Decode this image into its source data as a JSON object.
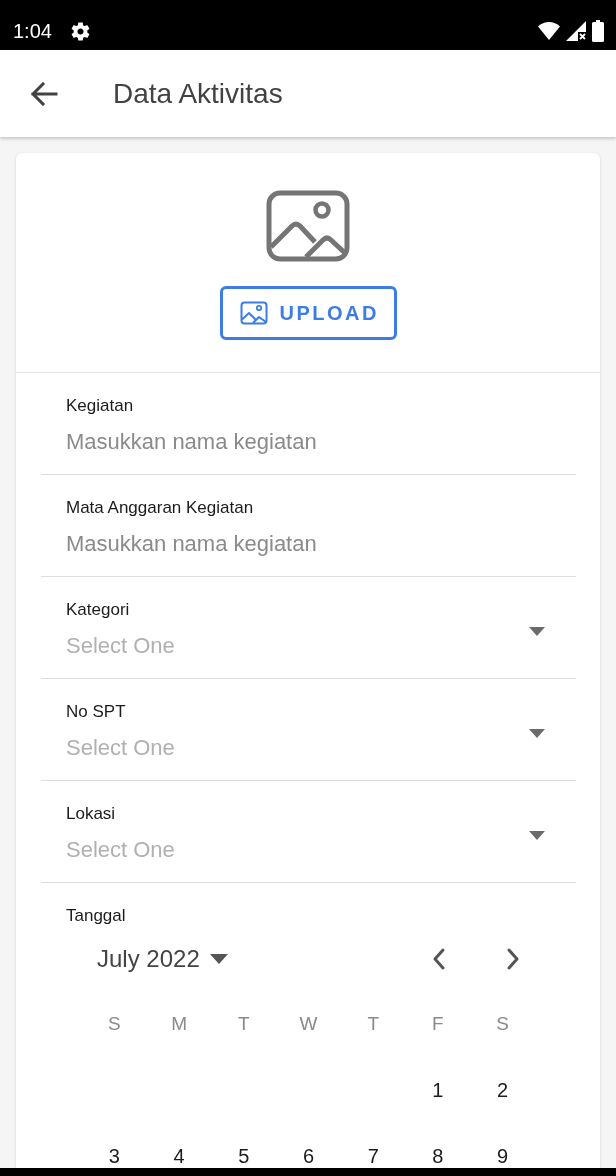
{
  "status_bar": {
    "time": "1:04"
  },
  "app_bar": {
    "title": "Data Aktivitas"
  },
  "upload": {
    "label": "UPLOAD"
  },
  "fields": [
    {
      "kind": "text",
      "label": "Kegiatan",
      "placeholder": "Masukkan nama kegiatan"
    },
    {
      "kind": "text",
      "label": "Mata Anggaran Kegiatan",
      "placeholder": "Masukkan nama kegiatan"
    },
    {
      "kind": "dropdown",
      "label": "Kategori",
      "placeholder": "Select One"
    },
    {
      "kind": "dropdown",
      "label": "No SPT",
      "placeholder": "Select One"
    },
    {
      "kind": "dropdown",
      "label": "Lokasi",
      "placeholder": "Select One"
    }
  ],
  "date_field": {
    "label": "Tanggal",
    "calendar": {
      "month": "July 2022",
      "weekdays": [
        "S",
        "M",
        "T",
        "W",
        "T",
        "F",
        "S"
      ],
      "weeks": [
        {
          "kind": "leading_gap",
          "days": [
            "1",
            "2"
          ]
        },
        {
          "kind": "full",
          "days": [
            "3",
            "4",
            "5",
            "6",
            "7",
            "8",
            "9"
          ]
        }
      ]
    }
  }
}
